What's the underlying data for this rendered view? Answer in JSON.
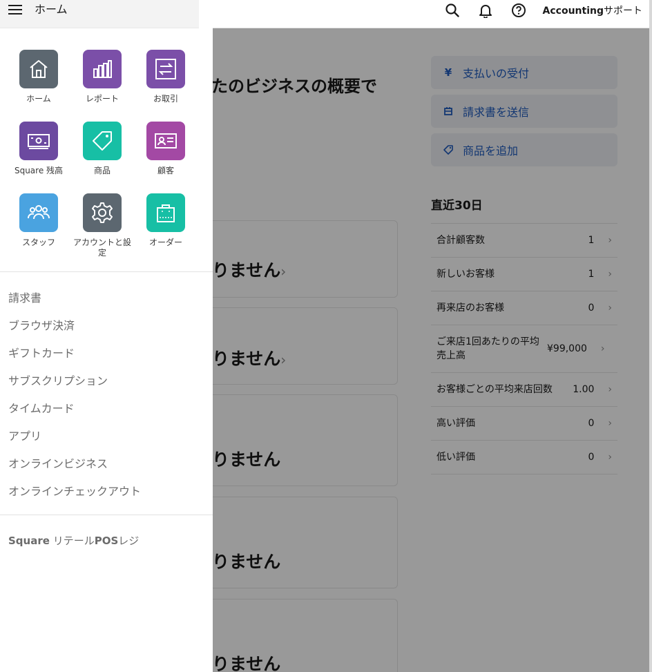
{
  "header": {
    "support_bold": "Accounting",
    "support_light": "サポート",
    "icons": [
      "search-icon",
      "bell-icon",
      "help-icon"
    ]
  },
  "drawer": {
    "title": "ホーム",
    "apps": [
      {
        "label": "ホーム",
        "color": "#5c6770",
        "icon": "home-icon"
      },
      {
        "label": "レポート",
        "color": "#7b4fa8",
        "icon": "report-icon"
      },
      {
        "label": "お取引",
        "color": "#7b4fa8",
        "icon": "transactions-icon"
      },
      {
        "label": "Square 残高",
        "color": "#6c4aa0",
        "icon": "balance-icon"
      },
      {
        "label": "商品",
        "color": "#17bfa5",
        "icon": "tag-icon"
      },
      {
        "label": "顧客",
        "color": "#a349a4",
        "icon": "customer-card-icon"
      },
      {
        "label": "スタッフ",
        "color": "#4aa3e0",
        "icon": "staff-icon"
      },
      {
        "label": "アカウントと設定",
        "color": "#5c6770",
        "icon": "gear-icon"
      },
      {
        "label": "オーダー",
        "color": "#17bfa5",
        "icon": "shopping-bag-icon"
      }
    ],
    "nav": [
      "請求書",
      "ブラウザ決済",
      "ギフトカード",
      "サブスクリプション",
      "タイムカード",
      "アプリ",
      "オンラインビジネス",
      "オンラインチェックアウト"
    ],
    "retail_bold_1": "Square",
    "retail_mid": " リテール",
    "retail_bold_2": "POS",
    "retail_end": "レジ"
  },
  "main": {
    "title": "たのビジネスの概要で",
    "actions": [
      {
        "label": "支払いの受付",
        "icon": "yen-icon"
      },
      {
        "label": "請求書を送信",
        "icon": "invoice-icon"
      },
      {
        "label": "商品を追加",
        "icon": "tag-icon"
      }
    ],
    "stats_title": "直近30日",
    "stats": [
      {
        "label": "合計顧客数",
        "value": "1"
      },
      {
        "label": "新しいお客様",
        "value": "1"
      },
      {
        "label": "再来店のお客様",
        "value": "0"
      },
      {
        "label": "ご来店1回あたりの平均売上高",
        "value": "¥99,000"
      },
      {
        "label": "お客様ごとの平均来店回数",
        "value": "1.00"
      },
      {
        "label": "高い評価",
        "value": "0"
      },
      {
        "label": "低い評価",
        "value": "0"
      }
    ],
    "card_text": "りません",
    "chevron": "›"
  }
}
